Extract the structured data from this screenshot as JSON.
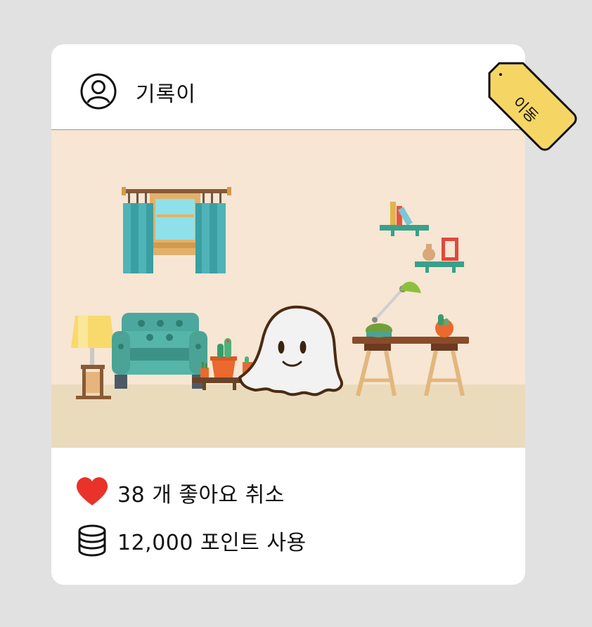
{
  "post": {
    "username": "기록이",
    "badge": "이동"
  },
  "stats": {
    "likes": "38 개  좋아요 취소",
    "points": "12,000 포인트 사용"
  },
  "colors": {
    "background": "#e1e1e1",
    "card": "#ffffff",
    "heart": "#e8322a",
    "tag": "#f5d665"
  },
  "icons": {
    "avatar": "user-circle-icon",
    "like": "heart-icon",
    "points": "coin-stack-icon",
    "badge": "price-tag-icon"
  }
}
